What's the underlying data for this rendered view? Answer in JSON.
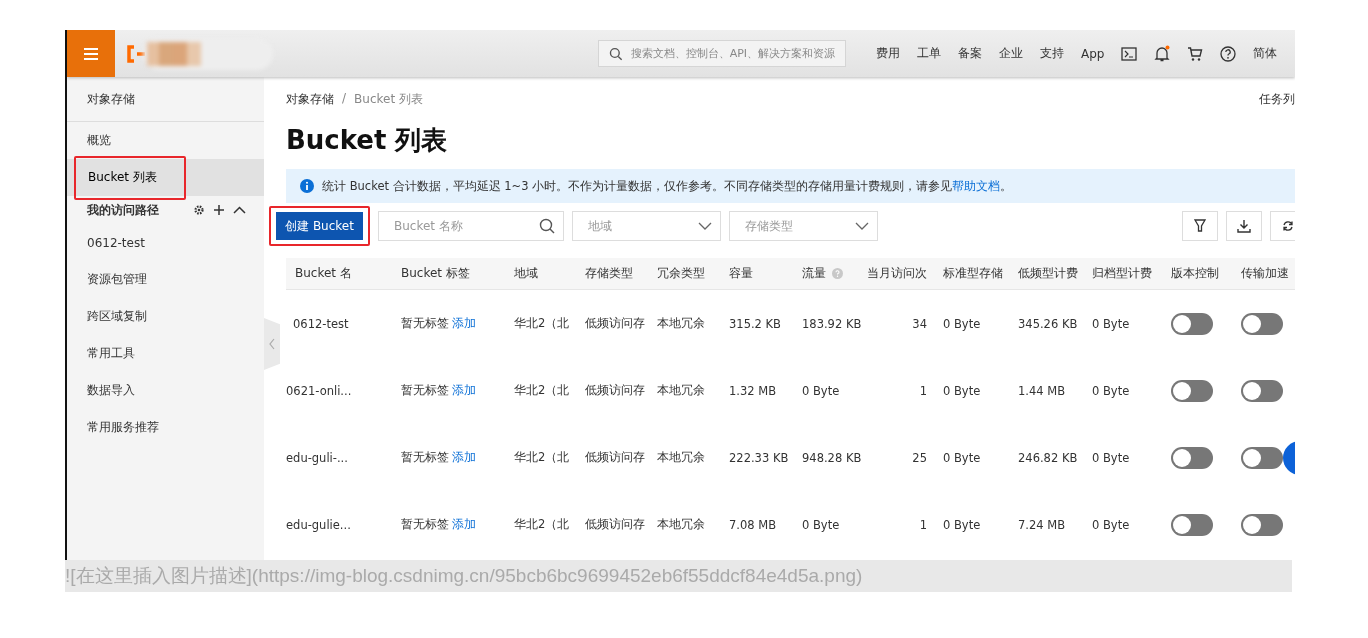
{
  "topbar": {
    "search": {
      "placeholder": "搜索文档、控制台、API、解决方案和资源"
    },
    "nav": [
      "费用",
      "工单",
      "备案",
      "企业",
      "支持",
      "App"
    ],
    "language": "简体",
    "notification_dot": true
  },
  "sidebar": {
    "title": "对象存储",
    "items": [
      {
        "label": "概览",
        "selected": false,
        "kind": "link"
      },
      {
        "label": "Bucket 列表",
        "selected": true,
        "annotated": true,
        "kind": "link"
      },
      {
        "label": "我的访问路径",
        "kind": "group"
      },
      {
        "label": "0612-test",
        "selected": false,
        "kind": "link"
      },
      {
        "label": "资源包管理",
        "selected": false,
        "kind": "link"
      },
      {
        "label": "跨区域复制",
        "selected": false,
        "kind": "link"
      },
      {
        "label": "常用工具",
        "selected": false,
        "kind": "link"
      },
      {
        "label": "数据导入",
        "selected": false,
        "kind": "link"
      },
      {
        "label": "常用服务推荐",
        "selected": false,
        "kind": "link"
      }
    ]
  },
  "breadcrumb": [
    "对象存储",
    "Bucket 列表"
  ],
  "breadcrumb_separator": "/",
  "task_list": "任务列",
  "page_title": "Bucket 列表",
  "info": {
    "text": "统计 Bucket 合计数据，平均延迟 1~3 小时。不作为计量数据，仅作参考。不同存储类型的存储用量计费规则，请参见",
    "link": "帮助文档",
    "suffix": "。"
  },
  "toolbar": {
    "create_button": {
      "label": "创建 Bucket",
      "annotated": true
    },
    "name_search": {
      "placeholder": "Bucket 名称"
    },
    "region_select": {
      "placeholder": "地域"
    },
    "storage_select": {
      "placeholder": "存储类型"
    }
  },
  "table": {
    "columns": [
      "Bucket 名",
      "Bucket 标签",
      "地域",
      "存储类型",
      "冗余类型",
      "容量",
      "流量",
      "当月访问次",
      "标准型存储",
      "低频型计费",
      "归档型计费",
      "版本控制",
      "传输加速"
    ],
    "rows": [
      {
        "name": "0612-test",
        "tag": "暂无标签",
        "tag_link": "添加",
        "region": "华北2（北",
        "storage": "低频访问存",
        "redundancy": "本地冗余",
        "capacity": "315.2 KB",
        "traffic": "183.92 KB",
        "visits": "34",
        "standard": "0 Byte",
        "ia": "345.26 KB",
        "archive": "0 Byte",
        "versioning": false,
        "acceleration": false
      },
      {
        "name": "0621-onli...",
        "tag": "暂无标签",
        "tag_link": "添加",
        "region": "华北2（北",
        "storage": "低频访问存",
        "redundancy": "本地冗余",
        "capacity": "1.32 MB",
        "traffic": "0 Byte",
        "visits": "1",
        "standard": "0 Byte",
        "ia": "1.44 MB",
        "archive": "0 Byte",
        "versioning": false,
        "acceleration": false
      },
      {
        "name": "edu-guli-...",
        "tag": "暂无标签",
        "tag_link": "添加",
        "region": "华北2（北",
        "storage": "低频访问存",
        "redundancy": "本地冗余",
        "capacity": "222.33 KB",
        "traffic": "948.28 KB",
        "visits": "25",
        "standard": "0 Byte",
        "ia": "246.82 KB",
        "archive": "0 Byte",
        "versioning": false,
        "acceleration": false
      },
      {
        "name": "edu-gulie...",
        "tag": "暂无标签",
        "tag_link": "添加",
        "region": "华北2（北",
        "storage": "低频访问存",
        "redundancy": "本地冗余",
        "capacity": "7.08 MB",
        "traffic": "0 Byte",
        "visits": "1",
        "standard": "0 Byte",
        "ia": "7.24 MB",
        "archive": "0 Byte",
        "versioning": false,
        "acceleration": false
      }
    ]
  },
  "markdown_line": "![在这里插入图片描述](https://img-blog.csdnimg.cn/95bcb6bc9699452eb6f55ddcf84e4d5a.png)"
}
